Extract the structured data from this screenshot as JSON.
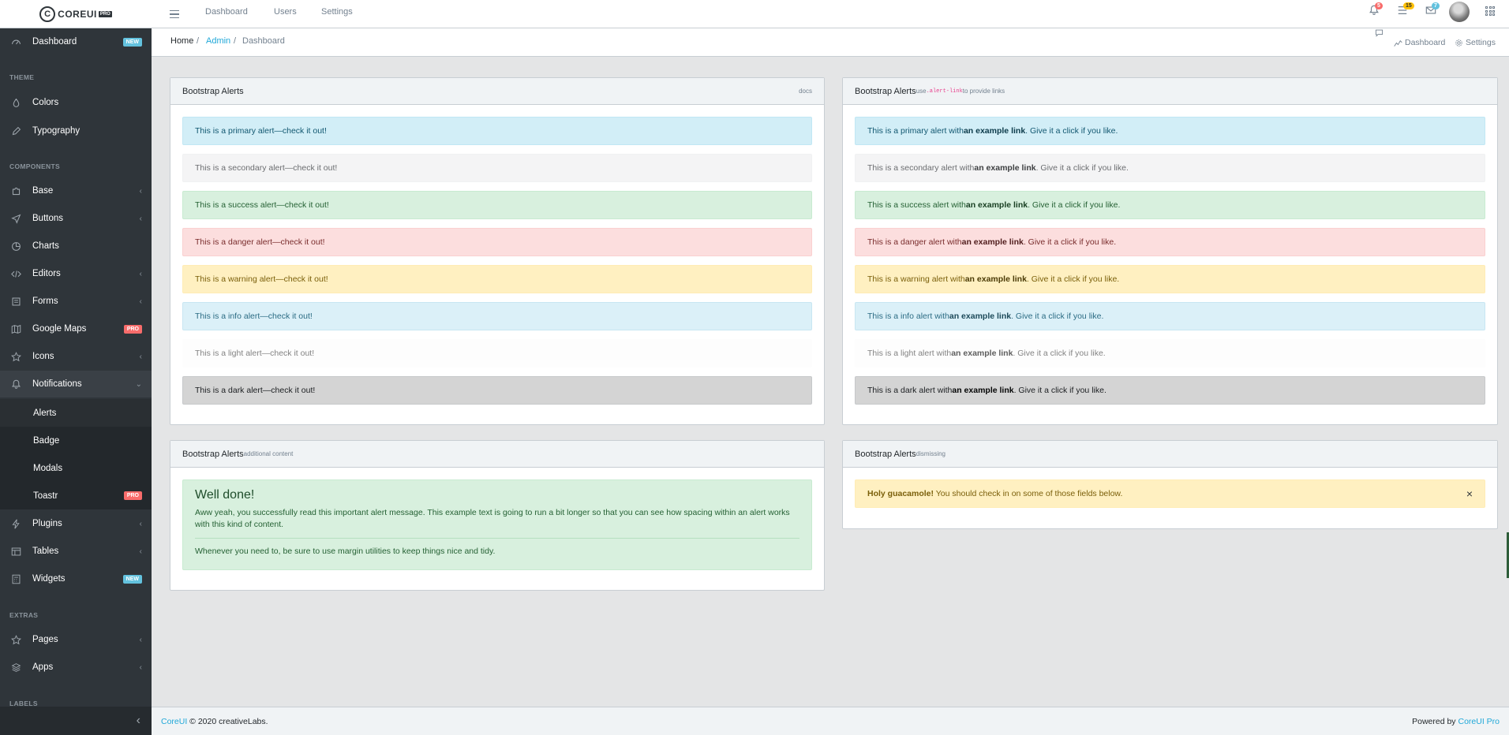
{
  "brand": {
    "logo_text": "COREUI",
    "logo_pro": "PRO",
    "logo_letter": "C"
  },
  "header": {
    "nav": [
      "Dashboard",
      "Users",
      "Settings"
    ],
    "notifications_count": "5",
    "tasks_count": "15",
    "messages_count": "7"
  },
  "sidebar": {
    "dashboard": {
      "label": "Dashboard",
      "badge": "NEW"
    },
    "title_theme": "THEME",
    "colors": "Colors",
    "typography": "Typography",
    "title_components": "COMPONENTS",
    "base": "Base",
    "buttons": "Buttons",
    "charts": "Charts",
    "editors": "Editors",
    "forms": "Forms",
    "google_maps": {
      "label": "Google Maps",
      "badge": "PRO"
    },
    "icons": "Icons",
    "notifications": "Notifications",
    "alerts": "Alerts",
    "badge": "Badge",
    "modals": "Modals",
    "toastr": {
      "label": "Toastr",
      "badge": "PRO"
    },
    "plugins": "Plugins",
    "tables": "Tables",
    "widgets": {
      "label": "Widgets",
      "badge": "NEW"
    },
    "title_extras": "EXTRAS",
    "pages": "Pages",
    "apps": "Apps",
    "title_labels": "LABELS"
  },
  "breadcrumb": {
    "home": "Home",
    "admin": "Admin",
    "current": "Dashboard",
    "sep": "/",
    "right_dashboard": "Dashboard",
    "right_settings": "Settings"
  },
  "card1": {
    "title": "Bootstrap Alerts",
    "docs": "docs",
    "alerts": [
      "This is a primary alert—check it out!",
      "This is a secondary alert—check it out!",
      "This is a success alert—check it out!",
      "This is a danger alert—check it out!",
      "This is a warning alert—check it out!",
      "This is a info alert—check it out!",
      "This is a light alert—check it out!",
      "This is a dark alert—check it out!"
    ]
  },
  "card2": {
    "title": "Bootstrap Alerts",
    "small_pre": "use ",
    "small_code": ".alert-link",
    "small_post": " to provide links",
    "link_text": "an example link",
    "link_suffix": ". Give it a click if you like.",
    "alerts": [
      "This is a primary alert with",
      "This is a secondary alert with",
      "This is a success alert with",
      "This is a danger alert with",
      "This is a warning alert with",
      "This is a info alert with",
      "This is a light alert with",
      "This is a dark alert with"
    ]
  },
  "card3": {
    "title": "Bootstrap Alerts",
    "small": "additional content",
    "heading": "Well done!",
    "body": "Aww yeah, you successfully read this important alert message. This example text is going to run a bit longer so that you can see how spacing within an alert works with this kind of content.",
    "footer_text": "Whenever you need to, be sure to use margin utilities to keep things nice and tidy."
  },
  "card4": {
    "title": "Bootstrap Alerts",
    "small": "dismissing",
    "strong": "Holy guacamole!",
    "text": " You should check in on some of those fields below.",
    "close": "×"
  },
  "footer": {
    "brand_link": "CoreUI",
    "copyright": " © 2020 creativeLabs.",
    "powered": "Powered by ",
    "powered_link": "CoreUI Pro"
  },
  "colors": {
    "primary": "#20a8d8",
    "sidebar": "#2f353a",
    "badge_new": "#63c2de",
    "badge_pro": "#f86c6b",
    "badge_notifications": "#f86c6b",
    "badge_tasks": "#ffc107",
    "badge_messages": "#63c2de"
  }
}
